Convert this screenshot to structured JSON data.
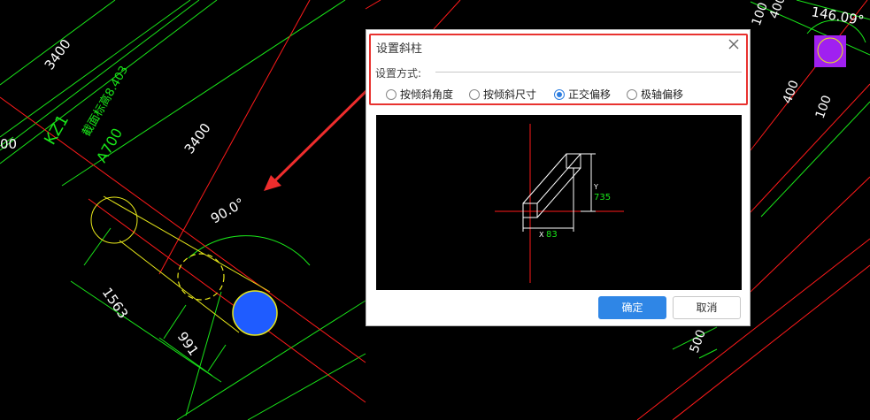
{
  "cad": {
    "dims": {
      "d3400_a": "3400",
      "d3400_b": "3400",
      "d1563": "1563",
      "d991": "991",
      "angle": "90.0°",
      "d00": "00",
      "d100_tr": "100",
      "d400_tr": "400",
      "angle_tr": "146.09°",
      "d400_r": "400",
      "d100_r": "100",
      "d500": "500"
    },
    "column_label": {
      "name": "KZ1",
      "elevation": "截面标高8.403",
      "size": "A700"
    },
    "colors": {
      "green": "#19e619",
      "red": "#ff1a1a",
      "yellow": "#e8e81a",
      "blue": "#1f5cff",
      "magenta": "#a020f0"
    }
  },
  "dialog": {
    "title": "设置斜柱",
    "method_label": "设置方式:",
    "options": [
      {
        "label": "按倾斜角度",
        "checked": false
      },
      {
        "label": "按倾斜尺寸",
        "checked": false
      },
      {
        "label": "正交偏移",
        "checked": true
      },
      {
        "label": "极轴偏移",
        "checked": false
      }
    ],
    "preview": {
      "y_prefix": "Y",
      "y_value": "735",
      "x_prefix": "X",
      "x_value": "83"
    },
    "ok_label": "确定",
    "cancel_label": "取消"
  }
}
